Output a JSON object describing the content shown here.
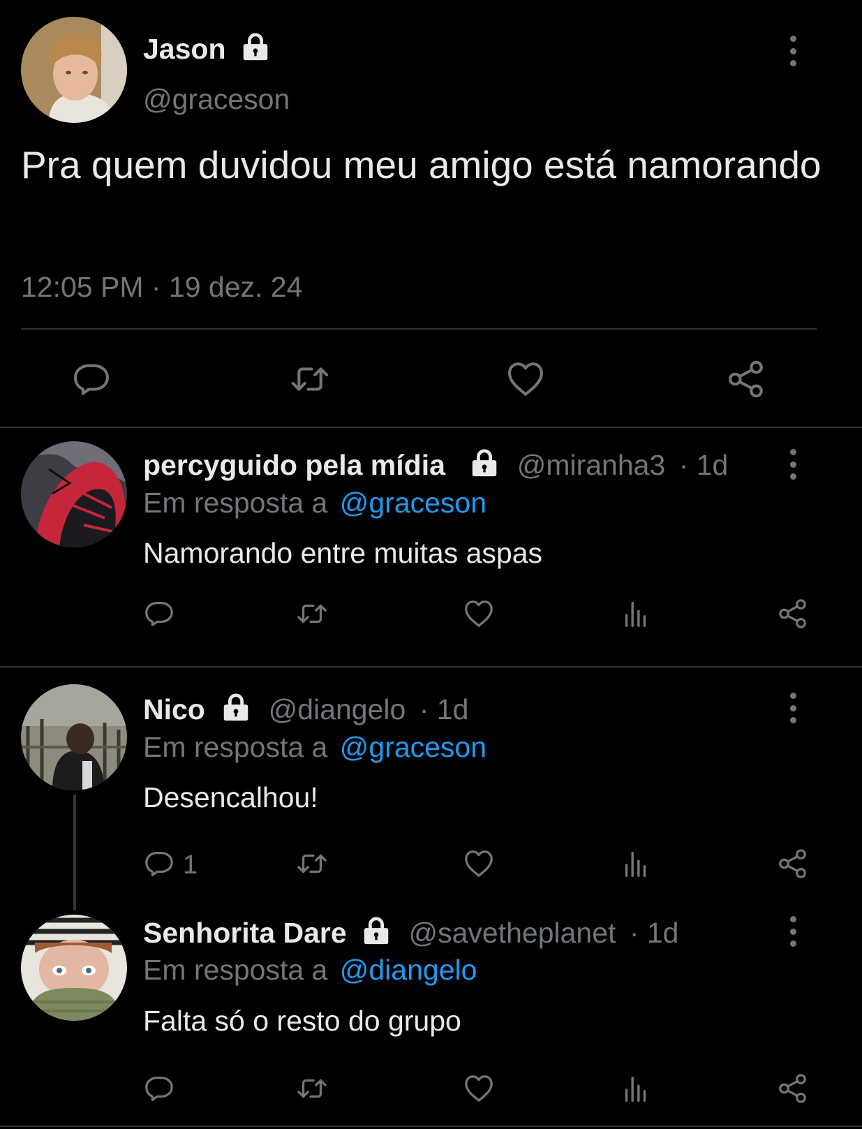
{
  "main_tweet": {
    "author_name": "Jason",
    "handle": "@graceson",
    "text": "Pra quem duvidou meu amigo está namorando",
    "timestamp": "12:05 PM · 19 dez. 24"
  },
  "replies": [
    {
      "author_name": "percyguido pela mídia",
      "handle": "@miranha3",
      "time": "· 1d",
      "reply_to_prefix": "Em resposta a",
      "reply_to": "@graceson",
      "text": "Namorando entre muitas aspas",
      "reply_count": ""
    },
    {
      "author_name": "Nico",
      "handle": "@diangelo",
      "time": "· 1d",
      "reply_to_prefix": "Em resposta a",
      "reply_to": "@graceson",
      "text": "Desencalhou!",
      "reply_count": "1"
    },
    {
      "author_name": "Senhorita Dare",
      "handle": "@savetheplanet",
      "time": "· 1d",
      "reply_to_prefix": "Em resposta a",
      "reply_to": "@diangelo",
      "text": "Falta só o resto do grupo",
      "reply_count": ""
    }
  ],
  "colors": {
    "background": "#000000",
    "text": "#e7e9ea",
    "secondary": "#71767b",
    "link": "#1d9bf0",
    "divider": "#2f3336"
  },
  "icons": [
    "lock-icon",
    "more-options-icon",
    "reply-icon",
    "retweet-icon",
    "like-icon",
    "views-icon",
    "share-icon"
  ]
}
